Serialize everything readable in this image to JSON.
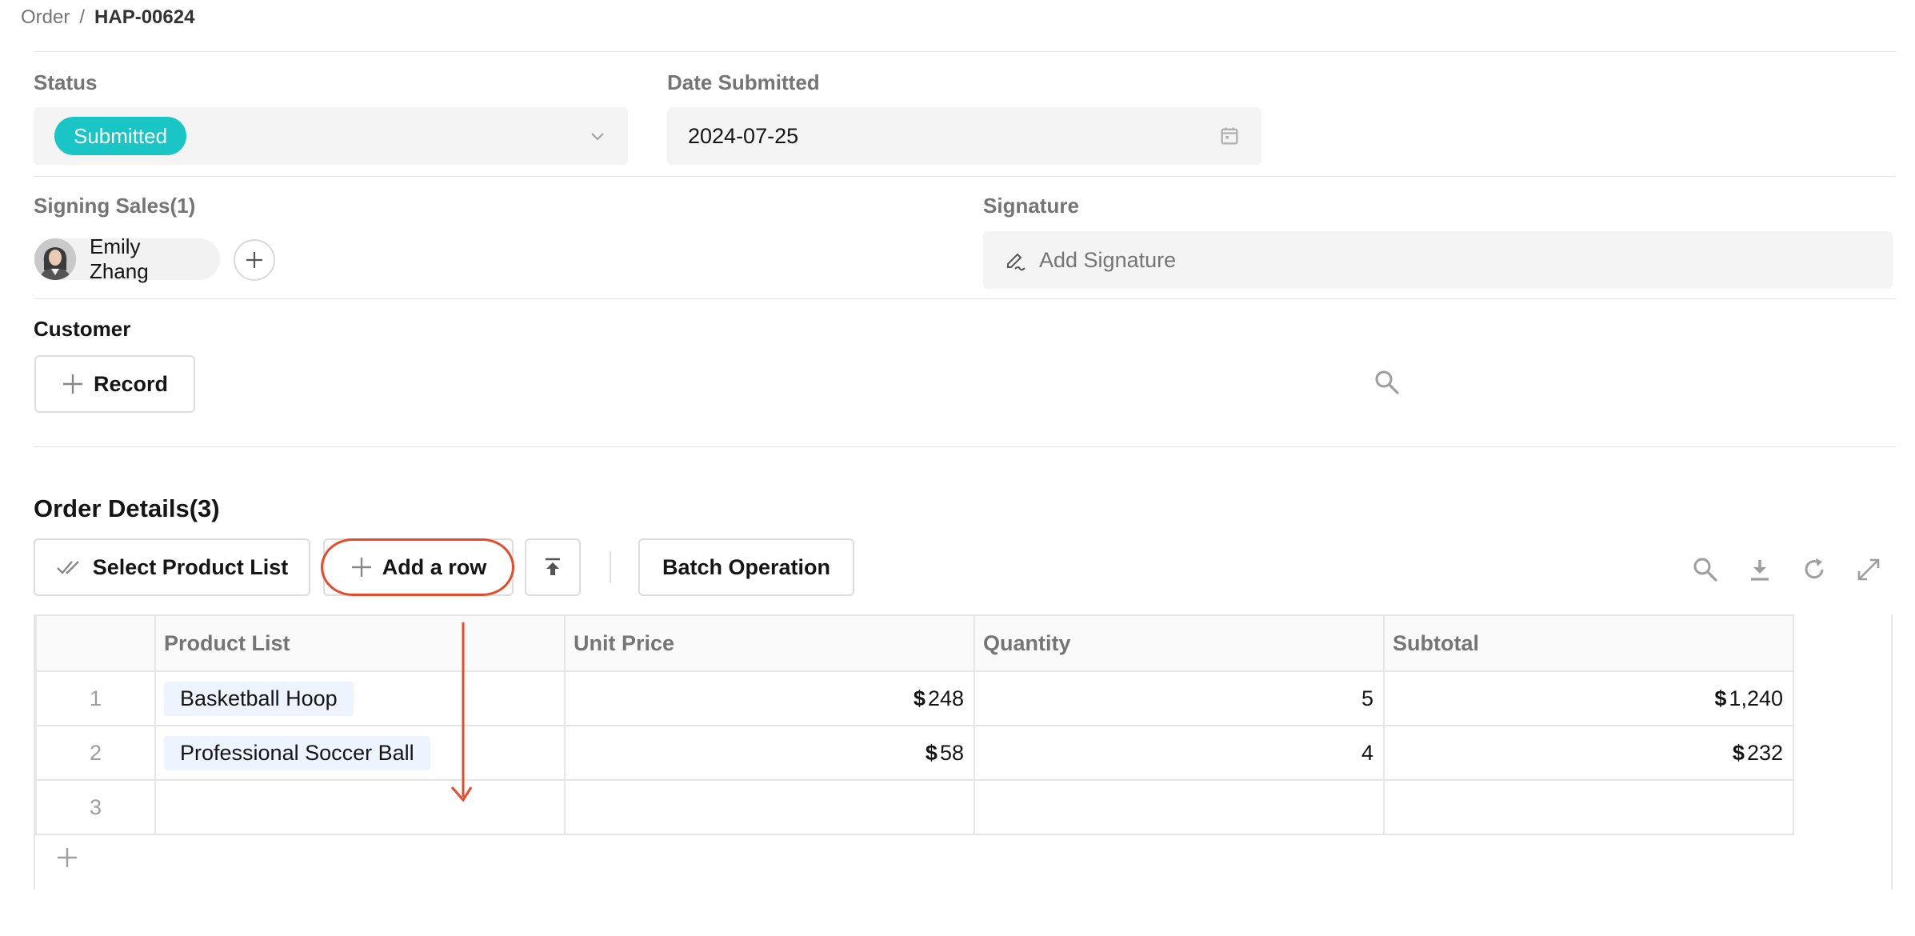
{
  "breadcrumb": {
    "parent": "Order",
    "separator": "/",
    "current": "HAP-00624"
  },
  "status": {
    "label": "Status",
    "value": "Submitted",
    "color": "#1ac5c6"
  },
  "date_submitted": {
    "label": "Date Submitted",
    "value": "2024-07-25"
  },
  "signing_sales": {
    "label": "Signing Sales(1)",
    "users": [
      {
        "name": "Emily Zhang"
      }
    ]
  },
  "signature": {
    "label": "Signature",
    "placeholder": "Add Signature"
  },
  "customer": {
    "label": "Customer",
    "record_button": "Record"
  },
  "order_details": {
    "title": "Order Details(3)",
    "toolbar": {
      "select_product_list": "Select Product List",
      "add_row": "Add a row",
      "batch_operation": "Batch Operation"
    },
    "columns": [
      "",
      "Product List",
      "Unit Price",
      "Quantity",
      "Subtotal"
    ],
    "rows": [
      {
        "index": "1",
        "product": "Basketball Hoop",
        "unit_price_currency": "$",
        "unit_price": "248",
        "quantity": "5",
        "subtotal_currency": "$",
        "subtotal": "1,240"
      },
      {
        "index": "2",
        "product": "Professional Soccer Ball",
        "unit_price_currency": "$",
        "unit_price": "58",
        "quantity": "4",
        "subtotal_currency": "$",
        "subtotal": "232"
      },
      {
        "index": "3",
        "product": "",
        "unit_price_currency": "",
        "unit_price": "",
        "quantity": "",
        "subtotal_currency": "",
        "subtotal": ""
      }
    ]
  },
  "icons": {
    "status_dropdown": "chevron-down-icon",
    "date": "calendar-icon",
    "add_user": "plus-circle-icon",
    "signature": "pen-icon",
    "customer_search": "search-icon",
    "select_product": "double-check-icon",
    "add_row": "plus-icon",
    "import": "upload-icon",
    "table_search": "search-icon",
    "download": "download-icon",
    "refresh": "refresh-icon",
    "fullscreen": "expand-icon"
  },
  "annotation_color": "#e8492b"
}
